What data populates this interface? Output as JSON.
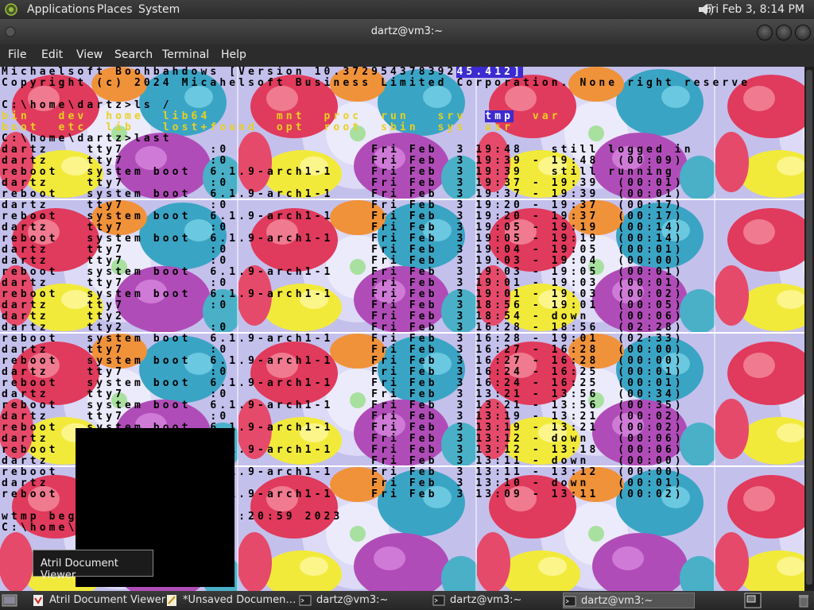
{
  "top_panel": {
    "menus": [
      "Applications",
      "Places",
      "System"
    ],
    "clock": "Fri Feb  3,  8:14 PM",
    "icons": [
      "distro-logo-icon",
      "volume-icon"
    ]
  },
  "window": {
    "title": "dartz@vm3:~",
    "menus": [
      "File",
      "Edit",
      "View",
      "Search",
      "Terminal",
      "Help"
    ]
  },
  "terminal": {
    "colors": {
      "text": "#000000",
      "red": "#e0101a",
      "yellow": "#e8d020",
      "highlight": "#3c2bd0"
    },
    "lines": [
      [
        {
          "t": "Michaelsoft Boohbahdows [Version 10.372954378392"
        },
        {
          "t": "45.412]",
          "c": "hl"
        }
      ],
      [
        {
          "t": "Copyright (c) 2024 Micahelsoft Business Limited Corporation. None right reserve"
        }
      ],
      [
        {
          "t": ""
        }
      ],
      [
        {
          "t": "C:\\home\\dartz>ls /"
        }
      ],
      [
        {
          "t": "bin   dev  home  lib64       mnt  proc  run   srv  ",
          "c": "yellow"
        },
        {
          "t": "tmp",
          "c": "hl"
        },
        {
          "t": "  var",
          "c": "yellow"
        }
      ],
      [
        {
          "t": "boot  etc  lib   lost+found  opt  root  sbin  sys  usr",
          "c": "yellow"
        }
      ],
      [
        {
          "t": "C:\\home\\dartz>last"
        }
      ],
      [
        {
          "t": "dartz    tty7         :0               Fri Feb  3 19:48   still logged in"
        }
      ],
      [
        {
          "t": "dartz    tty7         :0               Fri Feb  3 19:39 - 19:48  (00:09)"
        }
      ],
      [
        {
          "t": "reboot   system boot  6.1.9-arch1-1    Fri Feb  3 19:39   still running"
        }
      ],
      [
        {
          "t": "dartz    tty7         :0               Fri Feb  3 19:37 - 19:39  (00:01)"
        }
      ],
      [
        {
          "t": "reboot   system boot  6.1.9-arch1-1    Fri Feb  3 19:37 - 19:39  (00:01)"
        }
      ],
      [
        {
          "t": "dartz    tty7         :0               Fri Feb  3 19:20 - 19:37  (00:17)"
        }
      ],
      [
        {
          "t": "reboot   system boot  6.1.9-arch1-1    Fri Feb  3 19:20 - 19:37  (00:17)"
        }
      ],
      [
        {
          "t": "dartz    tty7         :0               Fri Feb  3 19:05 - 19:19  (00:14)"
        }
      ],
      [
        {
          "t": "reboot   system boot  6.1.9-arch1-1    Fri Feb  3 19:05 - 19:19  (00:14)"
        }
      ],
      [
        {
          "t": "dartz    tty7         :0               Fri Feb  3 19:04 - 19:05  (00:01)"
        }
      ],
      [
        {
          "t": "dartz    tty7         :0               Fri Feb  3 19:03 - 19:04  (00:00)"
        }
      ],
      [
        {
          "t": "reboot   system boot  6.1.9-arch1-1    Fri Feb  3 19:03 - 19:05  (00:01)"
        }
      ],
      [
        {
          "t": "dartz    tty7         :0               Fri Feb  3 19:01 - 19:03  (00:01)"
        }
      ],
      [
        {
          "t": "reboot   system boot  6.1.9-arch1-1    Fri Feb  3 19:01 - 19:03  (00:02)"
        }
      ],
      [
        {
          "t": "dartz    tty7         :0               Fri Feb  3 18:56 - 19:01  (00:05)"
        }
      ],
      [
        {
          "t": "dartz    tty2                          Fri Feb  3 18:54 - down   (00:06)"
        }
      ],
      [
        {
          "t": "dartz    tty2         :0               Fri Feb  3 16:28 - 18:56  (02:28)"
        }
      ],
      [
        {
          "t": "reboot   system boot  6.1.9-arch1-1    Fri Feb  3 16:28 - 19:01  (02:33)"
        }
      ],
      [
        {
          "t": "dartz    tty7         :0               Fri Feb  3 16:27 - 16:28  (00:00)"
        }
      ],
      [
        {
          "t": "reboot   system boot  6.1.9-arch1-1    Fri Feb  3 16:27 - 16:28  (00:00)"
        }
      ],
      [
        {
          "t": "dartz    tty7         :0               Fri Feb  3 16:24 - 16:25  (00:01)"
        }
      ],
      [
        {
          "t": "reboot   system boot  6.1.9-arch1-1    Fri Feb  3 16:24 - 16:25  (00:01)"
        }
      ],
      [
        {
          "t": "dartz    tty7         :0               Fri Feb  3 13:21 - 13:56  (00:34)"
        }
      ],
      [
        {
          "t": "reboot   system boot  6.1.9-arch1-1    Fri Feb  3 13:21 - 13:56  (00:35)"
        }
      ],
      [
        {
          "t": "dartz    tty7         :0               Fri Feb  3 13:19 - 13:21  (00:02)"
        }
      ],
      [
        {
          "t": "reboot   system boot  6.1.9-arch1-1    Fri Feb  3 13:19 - 13:21  (00:02)"
        }
      ],
      [
        {
          "t": "dartz    tty7         :0               Fri Feb  3 13:12 - down   (00:06)"
        }
      ],
      [
        {
          "t": "reboot   system boot  6.1.9-arch1-1    Fri Feb  3 13:12 - 13:18  (00:06)"
        }
      ],
      [
        {
          "t": "dartz    tty7         :0               Fri Feb  3 13:11 - down   (00:00)"
        }
      ],
      [
        {
          "t": "reboot   system boot  6.1.9-arch1-1    Fri Feb  3 13:11 - 13:12  (00:00)"
        }
      ],
      [
        {
          "t": "dartz    tty7         :0               Fri Feb  3 13:10 - down   (00:01)"
        }
      ],
      [
        {
          "t": "reboot   system boot  6.1.9-arch1-1    Fri Feb  3 13:09 - 13:11  (00:02)"
        }
      ],
      [
        {
          "t": ""
        }
      ],
      [
        {
          "t": "wtmp begins Mon Jan  2 12:20:59 2023"
        }
      ],
      [
        {
          "t": "C:\\home\\dartz>"
        }
      ]
    ]
  },
  "tooltip": {
    "text": "Atril Document Viewer"
  },
  "taskbar": {
    "items": [
      {
        "label": "Atril Document Viewer",
        "icon": "document-viewer-icon",
        "active": false
      },
      {
        "label": "*Unsaved Documen…",
        "icon": "text-editor-icon",
        "active": false
      },
      {
        "label": "dartz@vm3:~",
        "icon": "terminal-icon",
        "active": false
      },
      {
        "label": "dartz@vm3:~",
        "icon": "terminal-icon",
        "active": false
      },
      {
        "label": "dartz@vm3:~",
        "icon": "terminal-icon",
        "active": true
      }
    ]
  }
}
